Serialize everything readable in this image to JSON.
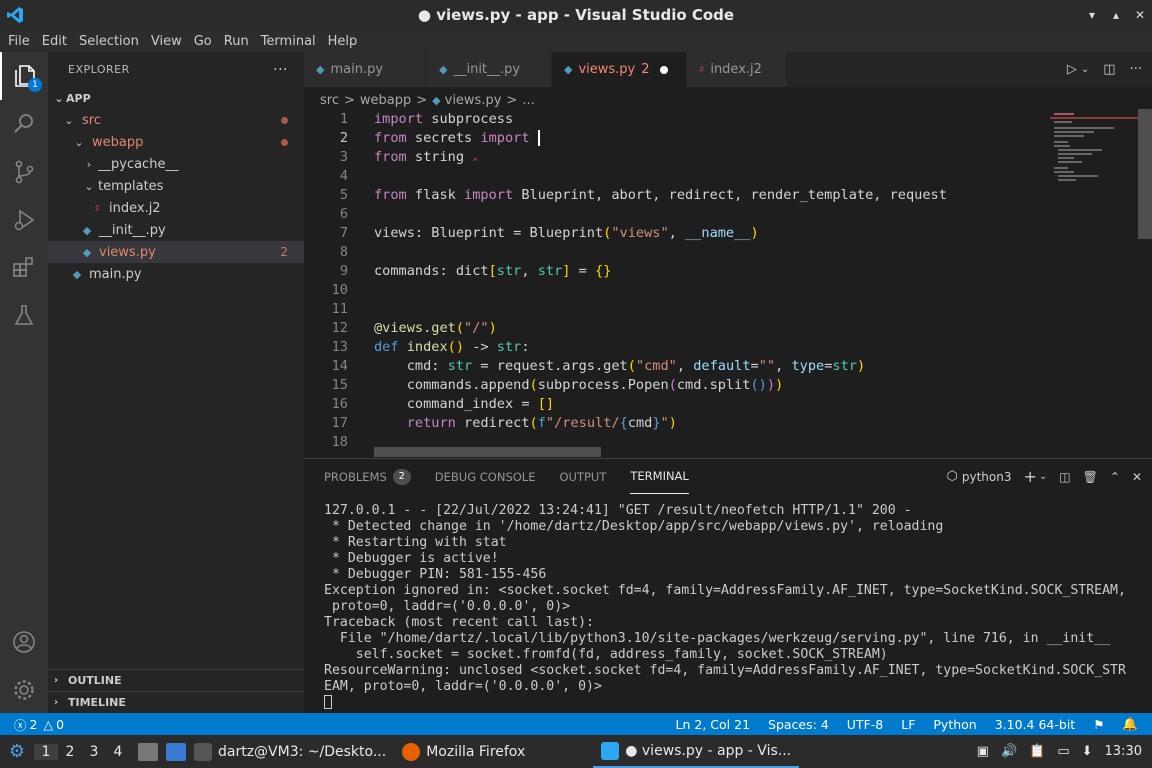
{
  "window": {
    "title": "● views.py - app - Visual Studio Code"
  },
  "menu": [
    "File",
    "Edit",
    "Selection",
    "View",
    "Go",
    "Run",
    "Terminal",
    "Help"
  ],
  "activity": {
    "explorer_badge": "1"
  },
  "explorer": {
    "header": "EXPLORER",
    "root": "APP",
    "items": [
      {
        "label": "src",
        "type": "folder-open",
        "color": "#e2876d",
        "dot": true
      },
      {
        "label": "webapp",
        "type": "folder-open",
        "color": "#e2876d",
        "dot": true
      },
      {
        "label": "__pycache__",
        "type": "folder-closed",
        "color": "#cccccc"
      },
      {
        "label": "templates",
        "type": "folder-open",
        "color": "#cccccc"
      },
      {
        "label": "index.j2",
        "type": "file-j2",
        "color": "#cccccc"
      },
      {
        "label": "__init__.py",
        "type": "file-py",
        "color": "#cccccc"
      },
      {
        "label": "views.py",
        "type": "file-py",
        "color": "#e2876d",
        "count": "2"
      },
      {
        "label": "main.py",
        "type": "file-py",
        "color": "#cccccc"
      }
    ],
    "outline": "OUTLINE",
    "timeline": "TIMELINE"
  },
  "tabs": [
    {
      "label": "main.py",
      "icon": "python-icon"
    },
    {
      "label": "__init__.py",
      "icon": "python-icon"
    },
    {
      "label": "views.py",
      "icon": "python-icon",
      "active": true,
      "count": "2",
      "modified": true
    },
    {
      "label": "index.j2",
      "icon": "jinja-icon"
    }
  ],
  "breadcrumb": [
    "src",
    ">",
    "webapp",
    ">",
    "views.py",
    ">",
    "..."
  ],
  "code_lines": [
    {
      "n": "1"
    },
    {
      "n": "2"
    },
    {
      "n": "3"
    },
    {
      "n": "4"
    },
    {
      "n": "5"
    },
    {
      "n": "6"
    },
    {
      "n": "7"
    },
    {
      "n": "8"
    },
    {
      "n": "9"
    },
    {
      "n": "10"
    },
    {
      "n": "11"
    },
    {
      "n": "12"
    },
    {
      "n": "13"
    },
    {
      "n": "14"
    },
    {
      "n": "15"
    },
    {
      "n": "16"
    },
    {
      "n": "17"
    },
    {
      "n": "18"
    }
  ],
  "panel": {
    "tabs": [
      "PROBLEMS",
      "DEBUG CONSOLE",
      "OUTPUT",
      "TERMINAL"
    ],
    "problems_count": "2",
    "terminal_name": "python3",
    "terminal_lines": [
      "127.0.0.1 - - [22/Jul/2022 13:24:41] \"GET /result/neofetch HTTP/1.1\" 200 -",
      " * Detected change in '/home/dartz/Desktop/app/src/webapp/views.py', reloading",
      " * Restarting with stat",
      " * Debugger is active!",
      " * Debugger PIN: 581-155-456",
      "Exception ignored in: <socket.socket fd=4, family=AddressFamily.AF_INET, type=SocketKind.SOCK_STREAM,",
      " proto=0, laddr=('0.0.0.0', 0)>",
      "Traceback (most recent call last):",
      "  File \"/home/dartz/.local/lib/python3.10/site-packages/werkzeug/serving.py\", line 716, in __init__",
      "    self.socket = socket.fromfd(fd, address_family, socket.SOCK_STREAM)",
      "ResourceWarning: unclosed <socket.socket fd=4, family=AddressFamily.AF_INET, type=SocketKind.SOCK_STR",
      "EAM, proto=0, laddr=('0.0.0.0', 0)>"
    ]
  },
  "status": {
    "errors": "2",
    "warnings": "0",
    "position": "Ln 2, Col 21",
    "spaces": "Spaces: 4",
    "encoding": "UTF-8",
    "eol": "LF",
    "language": "Python",
    "interpreter": "3.10.4 64-bit"
  },
  "taskbar": {
    "workspaces": [
      "1",
      "2",
      "3",
      "4"
    ],
    "items": [
      {
        "label": "dartz@VM3: ~/Deskto..."
      },
      {
        "label": "Mozilla Firefox"
      },
      {
        "label": "● views.py - app - Vis..."
      }
    ],
    "clock": "13:30"
  }
}
